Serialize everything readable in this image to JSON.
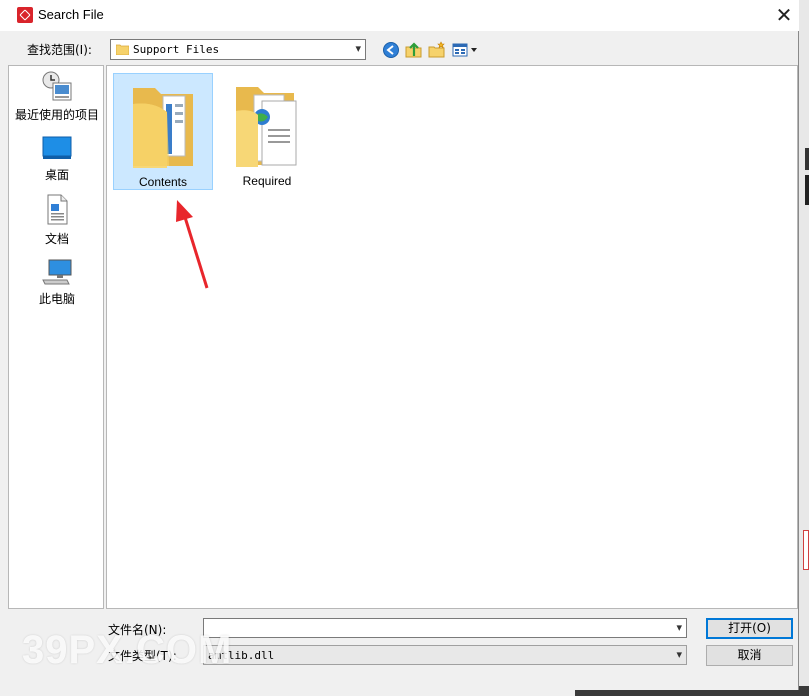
{
  "window": {
    "title": "Search File",
    "close_glyph": "✕"
  },
  "lookin": {
    "label": "查找范围(I):",
    "value": "Support Files"
  },
  "toolbar": {
    "icons": [
      "back-icon",
      "up-folder-icon",
      "new-folder-icon",
      "view-menu-icon"
    ]
  },
  "places": [
    {
      "label": "最近使用的项目",
      "icon": "recent-icon"
    },
    {
      "label": "桌面",
      "icon": "desktop-icon"
    },
    {
      "label": "文档",
      "icon": "documents-icon"
    },
    {
      "label": "此电脑",
      "icon": "computer-icon"
    }
  ],
  "files": [
    {
      "name": "Contents",
      "selected": true,
      "icon": "folder-icon"
    },
    {
      "name": "Required",
      "selected": false,
      "icon": "folder-with-docs-icon"
    }
  ],
  "filename": {
    "label": "文件名(N):",
    "value": ""
  },
  "filetype": {
    "label": "文件类型(T):",
    "value": "amtlib.dll"
  },
  "buttons": {
    "open": "打开(O)",
    "cancel": "取消"
  },
  "watermark": "39PX.COM",
  "colors": {
    "selection": "#cce8ff",
    "accent": "#0078d7",
    "annotation_arrow": "#e8262c"
  }
}
